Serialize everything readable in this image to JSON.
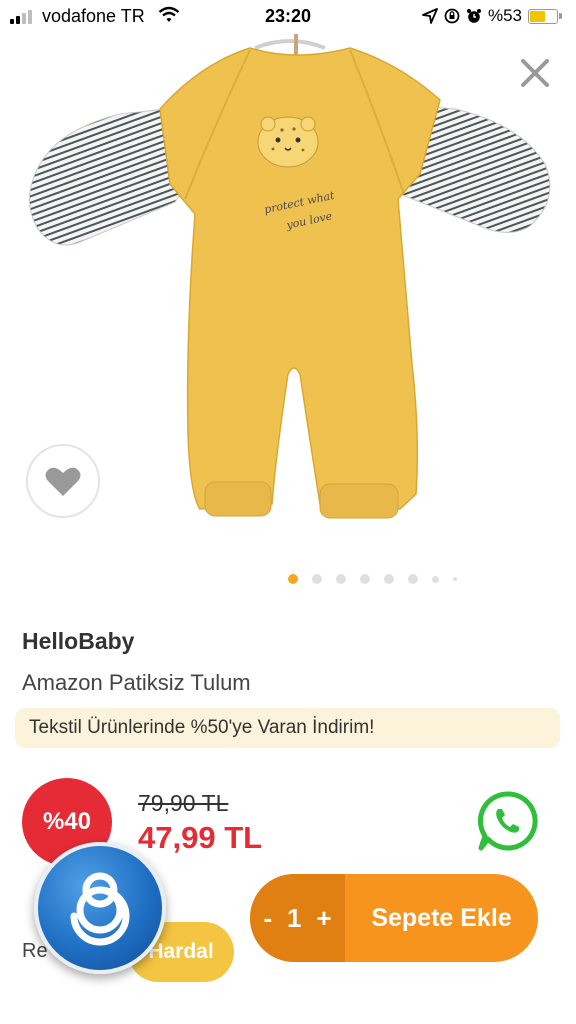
{
  "status_bar": {
    "carrier": "vodafone TR",
    "time": "23:20",
    "battery": "%53"
  },
  "product": {
    "brand": "HelloBaby",
    "name": "Amazon Patiksiz Tulum",
    "image_print_text": "protect what you love",
    "promo_text": "Tekstil Ürünlerinde %50'ye Varan İndirim!",
    "discount_badge": "%40",
    "old_price": "79,90 TL",
    "new_price": "47,99 TL",
    "image_count": 8,
    "active_image_index": 0
  },
  "cart": {
    "minus": "-",
    "quantity": "1",
    "plus": "+",
    "add_label": "Sepete Ekle"
  },
  "color": {
    "label_partial": "Re",
    "selected": "Hardal"
  },
  "colors": {
    "accent_orange": "#f7941d",
    "discount_red": "#e52b36",
    "promo_bg": "#fbf3da",
    "garment_yellow": "#efc24f",
    "color_chip": "#f4c542",
    "whatsapp_green": "#2fbf3a"
  },
  "icons": [
    "signal-icon",
    "wifi-icon",
    "location-icon",
    "lock-rotation-icon",
    "alarm-icon",
    "battery-icon",
    "close-icon",
    "heart-icon",
    "whatsapp-icon",
    "overlay-app-icon"
  ]
}
